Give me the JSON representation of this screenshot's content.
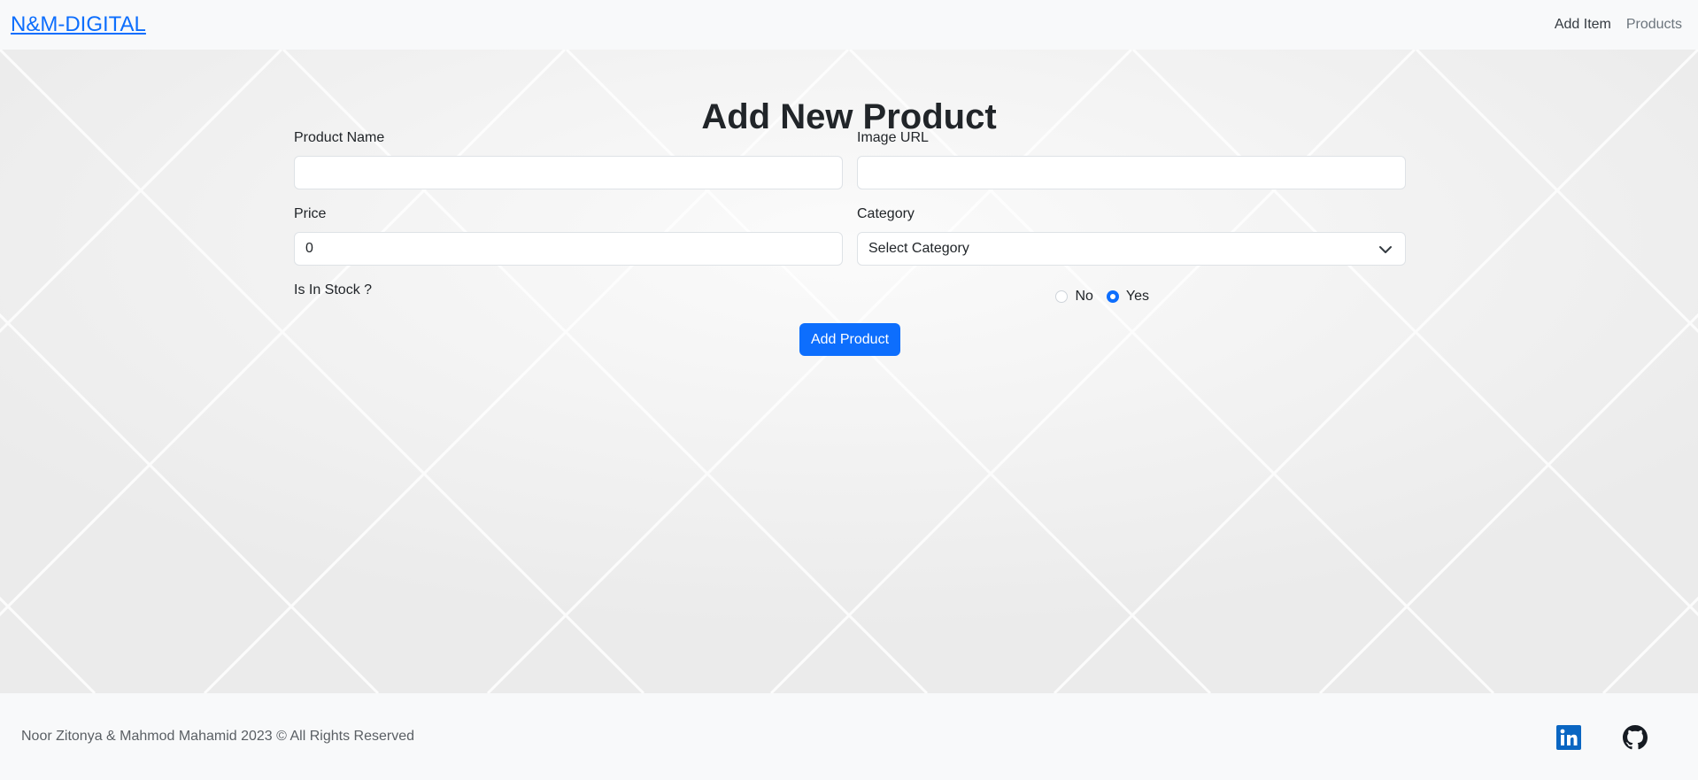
{
  "navbar": {
    "brand": "N&M-DIGITAL",
    "links": [
      "Add Item",
      "Products"
    ]
  },
  "form": {
    "title": "Add New Product",
    "product_name": {
      "label": "Product Name",
      "value": ""
    },
    "image_url": {
      "label": "Image URL",
      "value": ""
    },
    "price": {
      "label": "Price",
      "value": "0"
    },
    "category": {
      "label": "Category",
      "selected": "Select Category"
    },
    "in_stock": {
      "label": "Is In Stock ?",
      "options": [
        "No",
        "Yes"
      ],
      "selected": "Yes"
    },
    "submit_label": "Add Product"
  },
  "footer": {
    "copyright": "Noor Zitonya & Mahmod Mahamid 2023 © All Rights Reserved",
    "social_icons": [
      "linkedin-icon",
      "github-icon"
    ]
  },
  "colors": {
    "accent": "#0d6efd",
    "linkedin": "#0a66c2",
    "background": "#efefef"
  }
}
